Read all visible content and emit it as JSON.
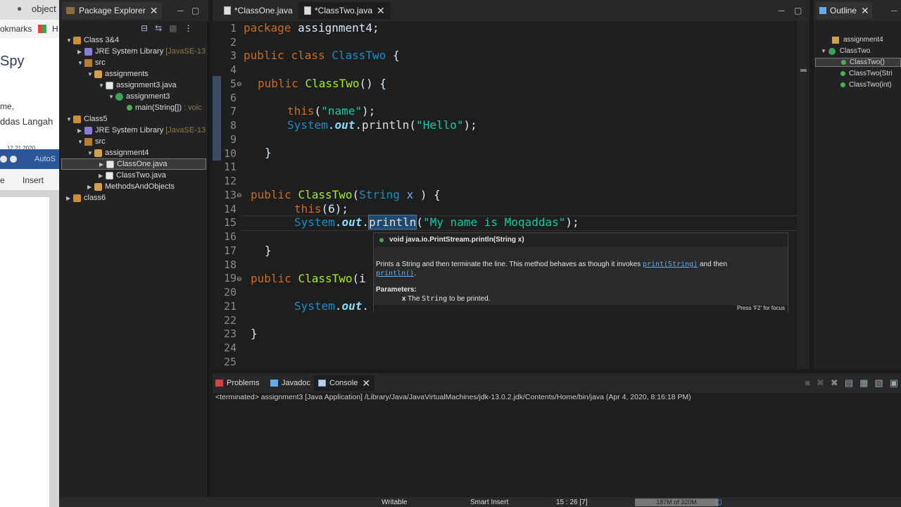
{
  "background_window": {
    "tab_title": "object",
    "bookmarks_text": "okmarks",
    "bookmark_letter": "H",
    "page_title": "Spy",
    "line1": "me,",
    "line2": "ddas Langah",
    "line3": "12.21.2020",
    "word_autosave": "AutoS",
    "ribbon_left": "e",
    "ribbon_insert": "Insert"
  },
  "package_explorer": {
    "tab_label": "Package Explorer",
    "tree": [
      {
        "label": "Class 3&4",
        "extra": ""
      },
      {
        "label": "JRE System Library",
        "extra": "[JavaSE-13"
      },
      {
        "label": "src",
        "extra": ""
      },
      {
        "label": "assignments",
        "extra": ""
      },
      {
        "label": "assignment3.java",
        "extra": ""
      },
      {
        "label": "assignment3",
        "extra": ""
      },
      {
        "label": "main(String[])",
        "extra": ": voic"
      },
      {
        "label": "Class5",
        "extra": ""
      },
      {
        "label": "JRE System Library",
        "extra": "[JavaSE-13"
      },
      {
        "label": "src",
        "extra": ""
      },
      {
        "label": "assignment4",
        "extra": ""
      },
      {
        "label": "ClassOne.java",
        "extra": ""
      },
      {
        "label": "ClassTwo.java",
        "extra": ""
      },
      {
        "label": "MethodsAndObjects",
        "extra": ""
      },
      {
        "label": "class6",
        "extra": ""
      }
    ]
  },
  "editor": {
    "tabs": [
      {
        "label": "*ClassOne.java"
      },
      {
        "label": "*ClassTwo.java"
      }
    ],
    "line_numbers": [
      "1",
      "2",
      "3",
      "4",
      "5",
      "6",
      "7",
      "8",
      "9",
      "10",
      "11",
      "12",
      "13",
      "14",
      "15",
      "16",
      "17",
      "18",
      "19",
      "20",
      "21",
      "22",
      "23",
      "24",
      "25"
    ],
    "code": {
      "l1_kw": "package",
      "l1_rest": " assignment4;",
      "l3_kw1": "public",
      "l3_kw2": "class",
      "l3_name": "ClassTwo",
      "l3_rest": " {",
      "l5_kw": "public",
      "l5_name": "ClassTwo",
      "l5_rest": "() {",
      "l7_kw": "this",
      "l7_p1": "(",
      "l7_str": "\"name\"",
      "l7_p2": ");",
      "l8_cls": "System",
      "l8_dot1": ".",
      "l8_out": "out",
      "l8_dot2": ".",
      "l8_meth": "println",
      "l8_p1": "(",
      "l8_str": "\"Hello\"",
      "l8_p2": ");",
      "l10": "}",
      "l13_kw": "public",
      "l13_name": "ClassTwo",
      "l13_p1": "(",
      "l13_type": "String",
      "l13_param": " x",
      "l13_rest": " ) {",
      "l14_kw": "this",
      "l14_rest": "(6);",
      "l15_cls": "System",
      "l15_dot1": ".",
      "l15_out": "out",
      "l15_dot2": ".",
      "l15_meth": "println",
      "l15_p1": "(",
      "l15_str": "\"My name is Moqaddas\"",
      "l15_p2": ");",
      "l17": "}",
      "l19_kw": "public",
      "l19_name": "ClassTwo",
      "l19_rest": "(i",
      "l21_cls": "System",
      "l21_dot1": ".",
      "l21_out": "out",
      "l21_dot2": ".",
      "l23": "}"
    }
  },
  "tooltip": {
    "signature": "void java.io.PrintStream.println(String x)",
    "desc_pre": "Prints a String and then terminate the line. This method behaves as though it invokes ",
    "link1": "print(String)",
    "desc_mid": " and then ",
    "link2": "println()",
    "desc_post": ".",
    "params_header": "Parameters:",
    "param_name": "x",
    "param_pre": " The ",
    "param_code": "String",
    "param_post": " to be printed.",
    "footer": "Press 'F2' for focus"
  },
  "outline": {
    "tab_label": "Outline",
    "items": [
      {
        "label": "assignment4"
      },
      {
        "label": "ClassTwo"
      },
      {
        "label": "ClassTwo()"
      },
      {
        "label": "ClassTwo(Stri"
      },
      {
        "label": "ClassTwo(int)"
      }
    ]
  },
  "console": {
    "tabs": [
      {
        "label": "Problems"
      },
      {
        "label": "Javadoc"
      },
      {
        "label": "Console"
      }
    ],
    "terminated_line": "<terminated> assignment3 [Java Application] /Library/Java/JavaVirtualMachines/jdk-13.0.2.jdk/Contents/Home/bin/java (Apr 4, 2020, 8:16:18 PM)"
  },
  "status_bar": {
    "writable": "Writable",
    "insert_mode": "Smart Insert",
    "position": "15 : 26 [7]",
    "heap": "187M of 320M"
  },
  "colors": {
    "keyword": "#cc6c1d",
    "class_name": "#1290c3",
    "string": "#17c6a3",
    "method": "#a7ec21"
  }
}
